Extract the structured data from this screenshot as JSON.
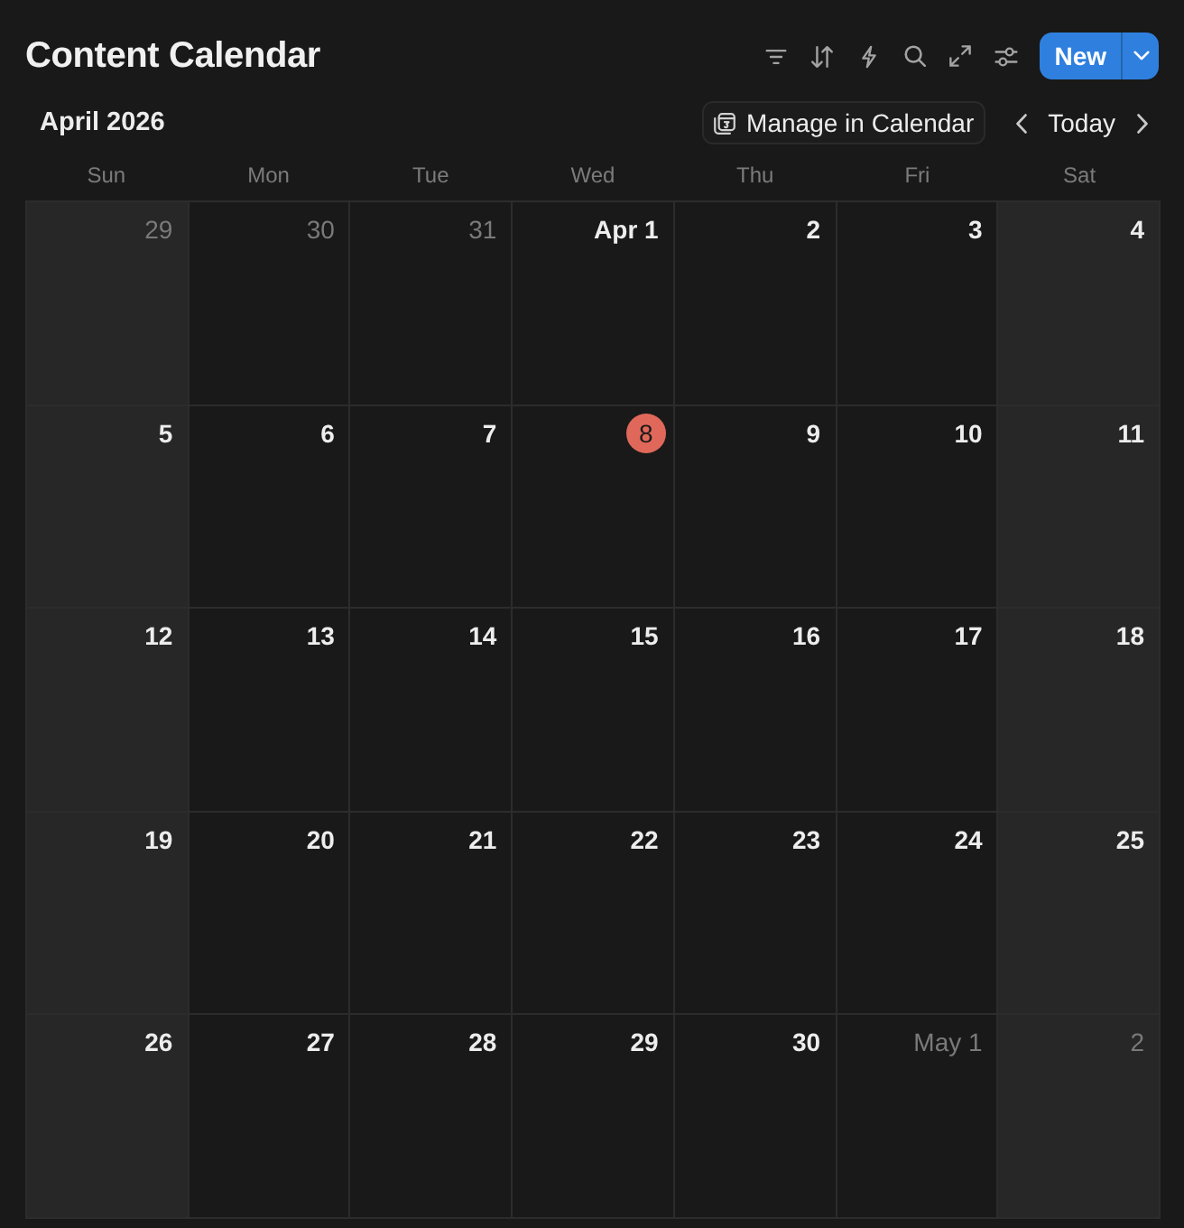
{
  "title": "Content Calendar",
  "new_button": {
    "label": "New"
  },
  "month": "April 2026",
  "manage_button": {
    "label": "Manage in Calendar"
  },
  "today_button": {
    "label": "Today"
  },
  "weekdays": [
    {
      "label": "Sun",
      "weekend": true
    },
    {
      "label": "Mon",
      "weekend": false
    },
    {
      "label": "Tue",
      "weekend": false
    },
    {
      "label": "Wed",
      "weekend": false
    },
    {
      "label": "Thu",
      "weekend": false
    },
    {
      "label": "Fri",
      "weekend": false
    },
    {
      "label": "Sat",
      "weekend": true
    }
  ],
  "weeks": [
    {
      "days": [
        {
          "label": "29",
          "in_month": false,
          "today": false
        },
        {
          "label": "30",
          "in_month": false,
          "today": false
        },
        {
          "label": "31",
          "in_month": false,
          "today": false
        },
        {
          "label": "Apr 1",
          "in_month": true,
          "today": false
        },
        {
          "label": "2",
          "in_month": true,
          "today": false
        },
        {
          "label": "3",
          "in_month": true,
          "today": false
        },
        {
          "label": "4",
          "in_month": true,
          "today": false
        }
      ]
    },
    {
      "days": [
        {
          "label": "5",
          "in_month": true,
          "today": false
        },
        {
          "label": "6",
          "in_month": true,
          "today": false
        },
        {
          "label": "7",
          "in_month": true,
          "today": false
        },
        {
          "label": "8",
          "in_month": true,
          "today": true
        },
        {
          "label": "9",
          "in_month": true,
          "today": false
        },
        {
          "label": "10",
          "in_month": true,
          "today": false
        },
        {
          "label": "11",
          "in_month": true,
          "today": false
        }
      ]
    },
    {
      "days": [
        {
          "label": "12",
          "in_month": true,
          "today": false
        },
        {
          "label": "13",
          "in_month": true,
          "today": false
        },
        {
          "label": "14",
          "in_month": true,
          "today": false
        },
        {
          "label": "15",
          "in_month": true,
          "today": false
        },
        {
          "label": "16",
          "in_month": true,
          "today": false
        },
        {
          "label": "17",
          "in_month": true,
          "today": false
        },
        {
          "label": "18",
          "in_month": true,
          "today": false
        }
      ]
    },
    {
      "days": [
        {
          "label": "19",
          "in_month": true,
          "today": false
        },
        {
          "label": "20",
          "in_month": true,
          "today": false
        },
        {
          "label": "21",
          "in_month": true,
          "today": false
        },
        {
          "label": "22",
          "in_month": true,
          "today": false
        },
        {
          "label": "23",
          "in_month": true,
          "today": false
        },
        {
          "label": "24",
          "in_month": true,
          "today": false
        },
        {
          "label": "25",
          "in_month": true,
          "today": false
        }
      ]
    },
    {
      "days": [
        {
          "label": "26",
          "in_month": true,
          "today": false
        },
        {
          "label": "27",
          "in_month": true,
          "today": false
        },
        {
          "label": "28",
          "in_month": true,
          "today": false
        },
        {
          "label": "29",
          "in_month": true,
          "today": false
        },
        {
          "label": "30",
          "in_month": true,
          "today": false
        },
        {
          "label": "May 1",
          "in_month": false,
          "today": false
        },
        {
          "label": "2",
          "in_month": false,
          "today": false
        }
      ]
    }
  ]
}
